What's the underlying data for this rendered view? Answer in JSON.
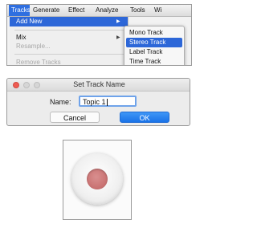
{
  "menubar": {
    "items": [
      "Tracks",
      "Generate",
      "Effect",
      "Analyze",
      "Tools",
      "Wi"
    ]
  },
  "tracks_menu": {
    "items": [
      {
        "label": "Add New",
        "highlighted": true,
        "submenu": true
      },
      {
        "label": "Mix",
        "submenu": true
      },
      {
        "label": "Resample...",
        "disabled": true
      },
      {
        "label": "Remove Tracks",
        "disabled": true
      }
    ]
  },
  "add_new_submenu": {
    "items": [
      {
        "label": "Mono Track"
      },
      {
        "label": "Stereo Track",
        "highlighted": true
      },
      {
        "label": "Label Track"
      },
      {
        "label": "Time Track"
      }
    ]
  },
  "dialog": {
    "title": "Set Track Name",
    "name_label": "Name:",
    "name_value": "Topic 1",
    "cancel_label": "Cancel",
    "ok_label": "OK"
  },
  "colors": {
    "highlight": "#2d67d8",
    "ok_button": "#1a73e8",
    "record_dot": "#c87070",
    "close_button": "#ee5b52"
  },
  "record_button": {
    "icon": "record-icon"
  }
}
